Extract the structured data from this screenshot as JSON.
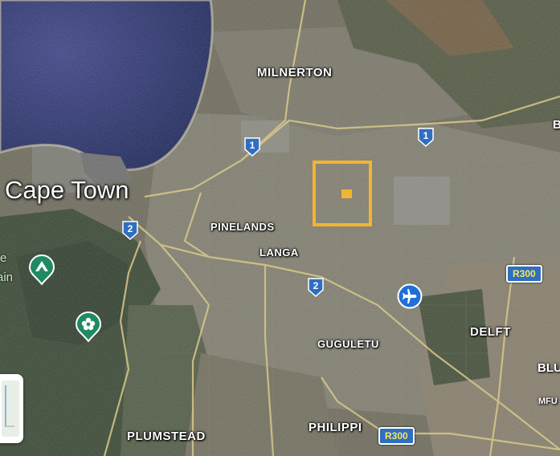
{
  "map": {
    "city_label": "Cape Town",
    "suburbs": {
      "milnerton": "MILNERTON",
      "pinelands": "PINELANDS",
      "langa": "LANGA",
      "guguletu": "GUGULETU",
      "delft": "DELFT",
      "philippi": "PHILIPPI",
      "plumstead": "PLUMSTEAD"
    },
    "edge_labels": {
      "right_top": "B",
      "right_mid": "BLU",
      "right_low": "MFU",
      "left_green_1": "e",
      "left_green_2": "ain"
    },
    "route_shields": [
      "1",
      "1",
      "2",
      "2"
    ],
    "regional_routes": [
      "R300",
      "R300"
    ],
    "icons": [
      "park-pin-icon",
      "garden-pin-icon",
      "airport-pin-icon",
      "route-shield-icon"
    ],
    "colors": {
      "highlight": "#f2b531",
      "shield": "#2f6fc0",
      "route_text": "#f7e55a",
      "ocean": "#1c2d6b",
      "park_pin": "#1f8a63"
    }
  }
}
